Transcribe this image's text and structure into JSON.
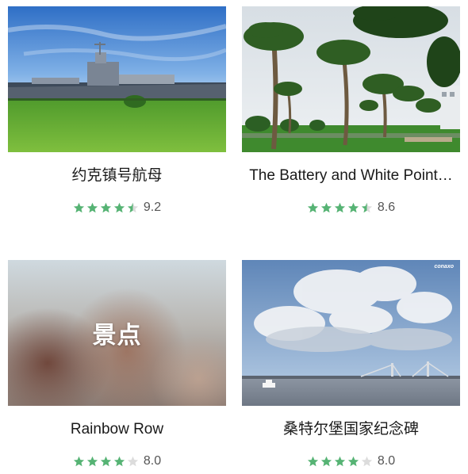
{
  "cards": [
    {
      "title": "约克镇号航母",
      "score": "9.2",
      "stars": 4.5,
      "image": "aircraft-carrier-photo"
    },
    {
      "title": "The Battery and White Point…",
      "score": "8.6",
      "stars": 4.5,
      "image": "palm-trees-park-photo"
    },
    {
      "title": "Rainbow Row",
      "score": "8.0",
      "stars": 4,
      "image": "placeholder-blurred",
      "placeholder_label": "景点"
    },
    {
      "title": "桑特尔堡国家纪念碑",
      "score": "8.0",
      "stars": 4,
      "image": "harbor-bridge-sky-photo",
      "watermark": "conaxo"
    }
  ],
  "colors": {
    "star_filled": "#56b374",
    "star_empty": "#dcdcdc",
    "title": "#1a1a1a",
    "score": "#555555"
  }
}
